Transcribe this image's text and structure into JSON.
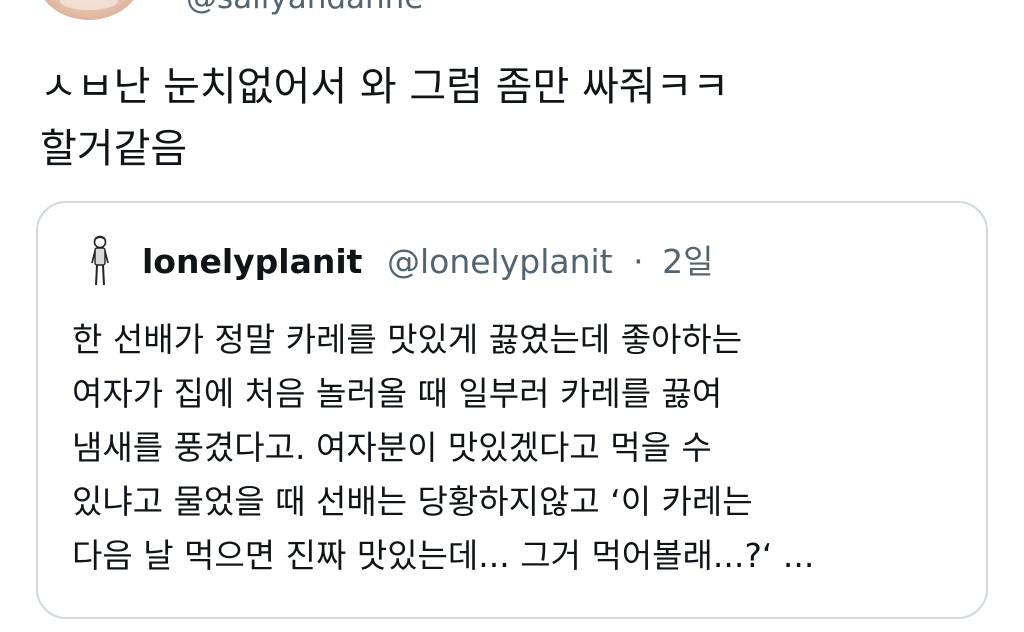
{
  "author": {
    "handle": "@sallyandanne"
  },
  "tweet": {
    "text": "ㅅㅂ난 눈치없어서 와 그럼 좀만 싸줘ㅋㅋ\n할거같음"
  },
  "quote": {
    "name": "lonelyplanit",
    "handle": "@lonelyplanit",
    "separator": "·",
    "time": "2일",
    "text": "한 선배가 정말 카레를 맛있게 끓였는데 좋아하는\n여자가 집에 처음 놀러올 때 일부러 카레를 끓여\n냄새를 풍겼다고. 여자분이 맛있겠다고 먹을 수\n있냐고 물었을 때 선배는 당황하지않고 ‘이 카레는\n다음 날 먹으면 진짜 맛있는데... 그거 먹어볼래...?‘ ..."
  }
}
